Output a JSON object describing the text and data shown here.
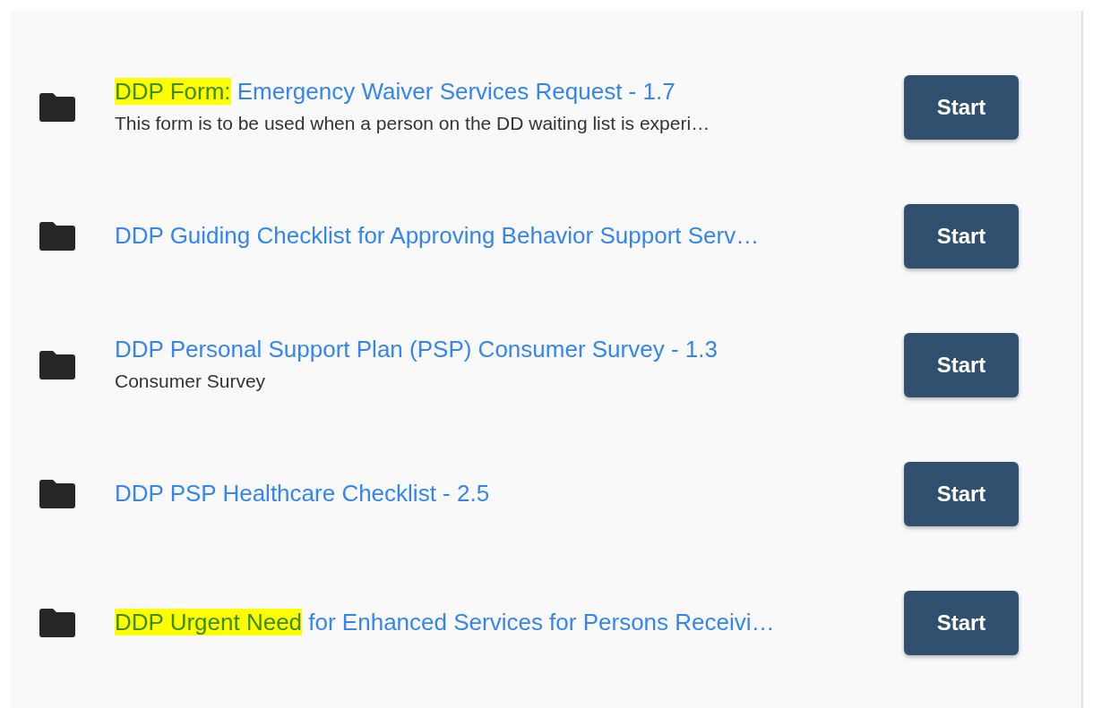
{
  "forms": [
    {
      "title": [
        {
          "text": "DDP Form:",
          "highlighted": true
        },
        {
          "text": " Emergency Waiver Services Request - 1.7",
          "highlighted": false
        }
      ],
      "description": "This form is to be used when a person on the DD waiting list is experi…",
      "button": "Start"
    },
    {
      "title": [
        {
          "text": "DDP Guiding Checklist for Approving Behavior Support Serv…",
          "highlighted": false
        }
      ],
      "button": "Start"
    },
    {
      "title": [
        {
          "text": "DDP Personal Support Plan (PSP) Consumer Survey - 1.3",
          "highlighted": false
        }
      ],
      "description": "Consumer Survey",
      "button": "Start"
    },
    {
      "title": [
        {
          "text": "DDP PSP Healthcare Checklist - 2.5",
          "highlighted": false
        }
      ],
      "button": "Start"
    },
    {
      "title": [
        {
          "text": "DDP Urgent Need",
          "highlighted": true
        },
        {
          "text": " for Enhanced Services for Persons Receivi…",
          "highlighted": false
        }
      ],
      "button": "Start"
    }
  ]
}
